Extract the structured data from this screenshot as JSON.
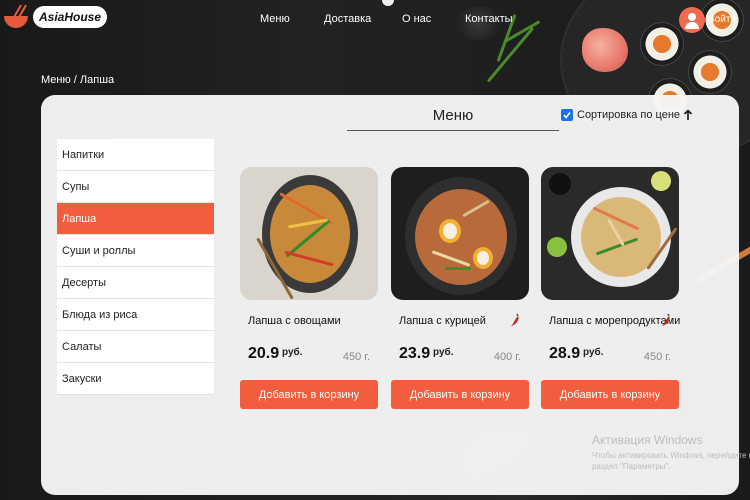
{
  "header": {
    "logo_text": "AsiaHouse",
    "nav": [
      {
        "label": "Меню"
      },
      {
        "label": "Доставка"
      },
      {
        "label": "О нас"
      },
      {
        "label": "Контакты"
      }
    ],
    "login_label": "Войти"
  },
  "breadcrumb": "Меню / Лапша",
  "panel": {
    "title": "Меню",
    "sort_label": "Сортировка по цене",
    "sort_checked": true
  },
  "categories": [
    {
      "label": "Напитки",
      "active": false
    },
    {
      "label": "Супы",
      "active": false
    },
    {
      "label": "Лапша",
      "active": true
    },
    {
      "label": "Суши и роллы",
      "active": false
    },
    {
      "label": "Десерты",
      "active": false
    },
    {
      "label": "Блюда из риса",
      "active": false
    },
    {
      "label": "Салаты",
      "active": false
    },
    {
      "label": "Закуски",
      "active": false
    }
  ],
  "products": [
    {
      "name": "Лапша с овощами",
      "price": "20.9",
      "currency": "руб.",
      "weight": "450 г.",
      "spicy": false,
      "button": "Добавить в корзину"
    },
    {
      "name": "Лапша с курицей",
      "price": "23.9",
      "currency": "руб.",
      "weight": "400 г.",
      "spicy": true,
      "button": "Добавить в корзину"
    },
    {
      "name": "Лапша с морепродуктами",
      "price": "28.9",
      "currency": "руб.",
      "weight": "450 г.",
      "spicy": true,
      "button": "Добавить в корзину"
    }
  ],
  "watermark": {
    "title": "Активация Windows",
    "text": "Чтобы активировать Windows, перейдите в раздел \"Параметры\"."
  },
  "colors": {
    "accent": "#f25e3d",
    "checkbox": "#1a73e8",
    "panel_bg": "#f5f5f5"
  },
  "icons": [
    "logo-bowl-icon",
    "user-icon",
    "checkbox-icon",
    "arrow-up-icon",
    "chili-icon"
  ]
}
